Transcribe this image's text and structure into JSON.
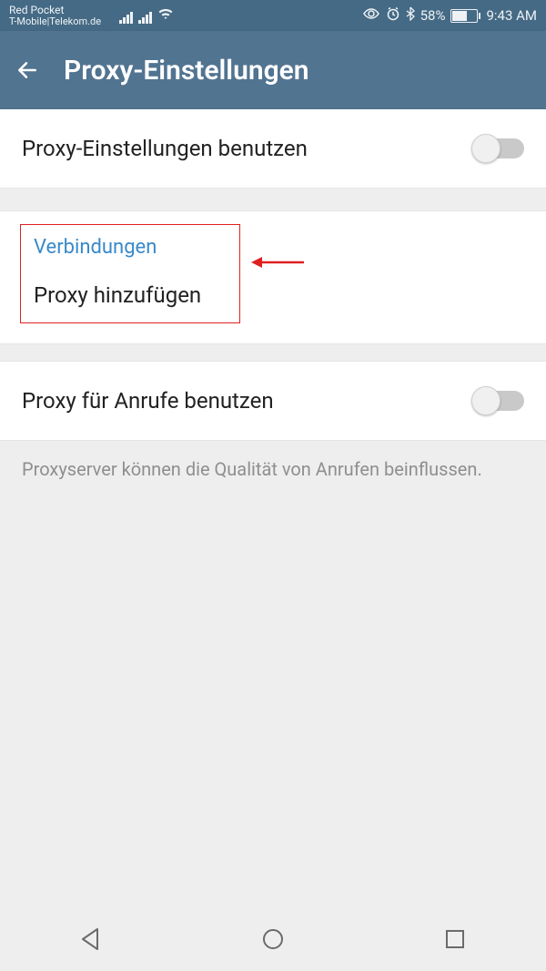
{
  "status": {
    "carrier1": "Red Pocket",
    "carrier2": "T-Mobile|Telekom.de",
    "battery_pct": "58%",
    "time": "9:43 AM"
  },
  "appbar": {
    "title": "Proxy-Einstellungen"
  },
  "settings": {
    "use_proxy_label": "Proxy-Einstellungen benutzen",
    "connections_header": "Verbindungen",
    "add_proxy_label": "Proxy hinzufügen",
    "use_proxy_calls_label": "Proxy für Anrufe benutzen",
    "note": "Proxyserver können die Qualität von Anrufen beinflussen."
  }
}
